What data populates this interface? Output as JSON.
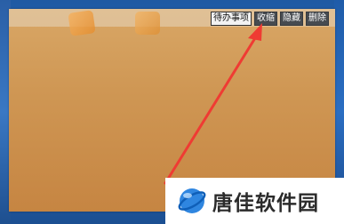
{
  "toolbar": {
    "todo_label": "待办事项",
    "collapse_label": "收缩",
    "hide_label": "隐藏",
    "delete_label": "删除"
  },
  "watermark": {
    "text": "唐佳软件园",
    "logo_icon": "blue-sphere-logo"
  },
  "colors": {
    "note_background": "#cf9754",
    "annotation_arrow": "#ef3b33",
    "desktop_background": "#2668b5",
    "button_dark": "#474b50"
  }
}
